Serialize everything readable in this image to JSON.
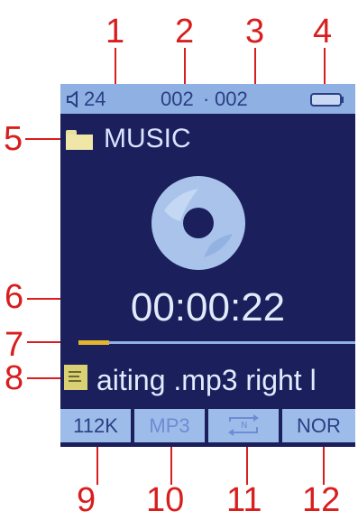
{
  "callouts": [
    "1",
    "2",
    "3",
    "4",
    "5",
    "6",
    "7",
    "8",
    "9",
    "10",
    "11",
    "12"
  ],
  "status": {
    "volume_icon": "speaker-icon",
    "volume": "24",
    "track_current": "002",
    "separator": "·",
    "track_total": "002",
    "battery_icon": "battery-icon"
  },
  "folder": {
    "icon": "folder-icon",
    "label": "MUSIC"
  },
  "player": {
    "disc_icon": "disc-icon",
    "elapsed": "00:00:22",
    "progress_fraction": 0.11
  },
  "file": {
    "icon": "file-icon",
    "name": "aiting .mp3 right l"
  },
  "bottom": {
    "bitrate": "112K",
    "format": "MP3",
    "repeat_icon": "repeat-mode-icon",
    "eq": "NOR"
  },
  "colors": {
    "screen_bg": "#1b1f5c",
    "bar_bg": "#8fb0e2",
    "bar_text": "#2a3f85",
    "progress": "#e3b52e",
    "callout": "#d81e1e"
  }
}
